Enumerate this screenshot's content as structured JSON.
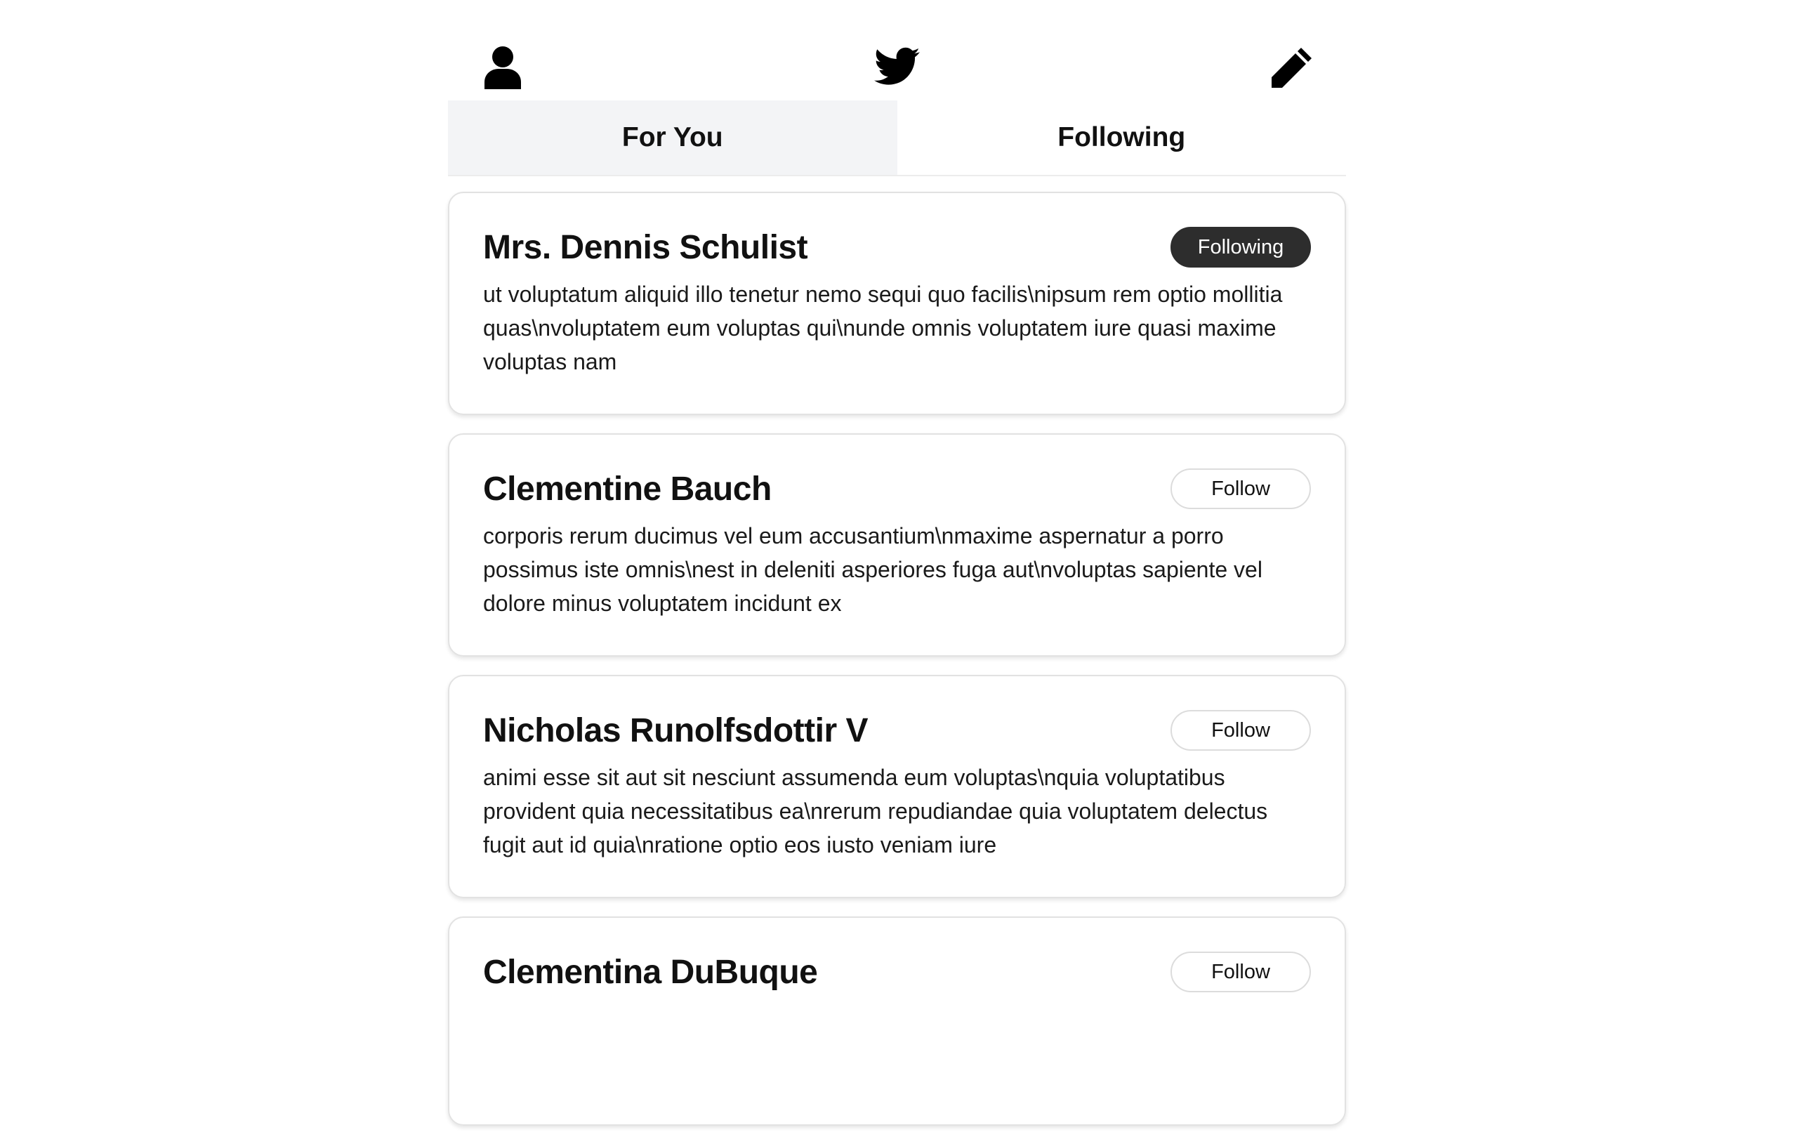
{
  "header": {
    "icons": [
      "user-icon",
      "twitter-bird-icon",
      "pencil-icon"
    ]
  },
  "tabs": [
    {
      "label": "For You",
      "active": true
    },
    {
      "label": "Following",
      "active": false
    }
  ],
  "posts": [
    {
      "author": "Mrs. Dennis Schulist",
      "button_label": "Following",
      "body": "ut voluptatum aliquid illo tenetur nemo sequi quo facilis\\nipsum rem optio mollitia quas\\nvoluptatem eum voluptas qui\\nunde omnis voluptatem iure quasi maxime voluptas nam"
    },
    {
      "author": "Clementine Bauch",
      "button_label": "Follow",
      "body": "corporis rerum ducimus vel eum accusantium\\nmaxime aspernatur a porro possimus iste omnis\\nest in deleniti asperiores fuga aut\\nvoluptas sapiente vel dolore minus voluptatem incidunt ex"
    },
    {
      "author": "Nicholas Runolfsdottir V",
      "button_label": "Follow",
      "body": "animi esse sit aut sit nesciunt assumenda eum voluptas\\nquia voluptatibus provident quia necessitatibus ea\\nrerum repudiandae quia voluptatem delectus fugit aut id quia\\nratione optio eos iusto veniam iure"
    },
    {
      "author": "Clementina DuBuque",
      "button_label": "Follow",
      "body": ""
    }
  ],
  "colors": {
    "active_tab_bg": "#f3f4f6",
    "following_button_bg": "#2d2d2d",
    "card_border": "#e2e2e2"
  }
}
